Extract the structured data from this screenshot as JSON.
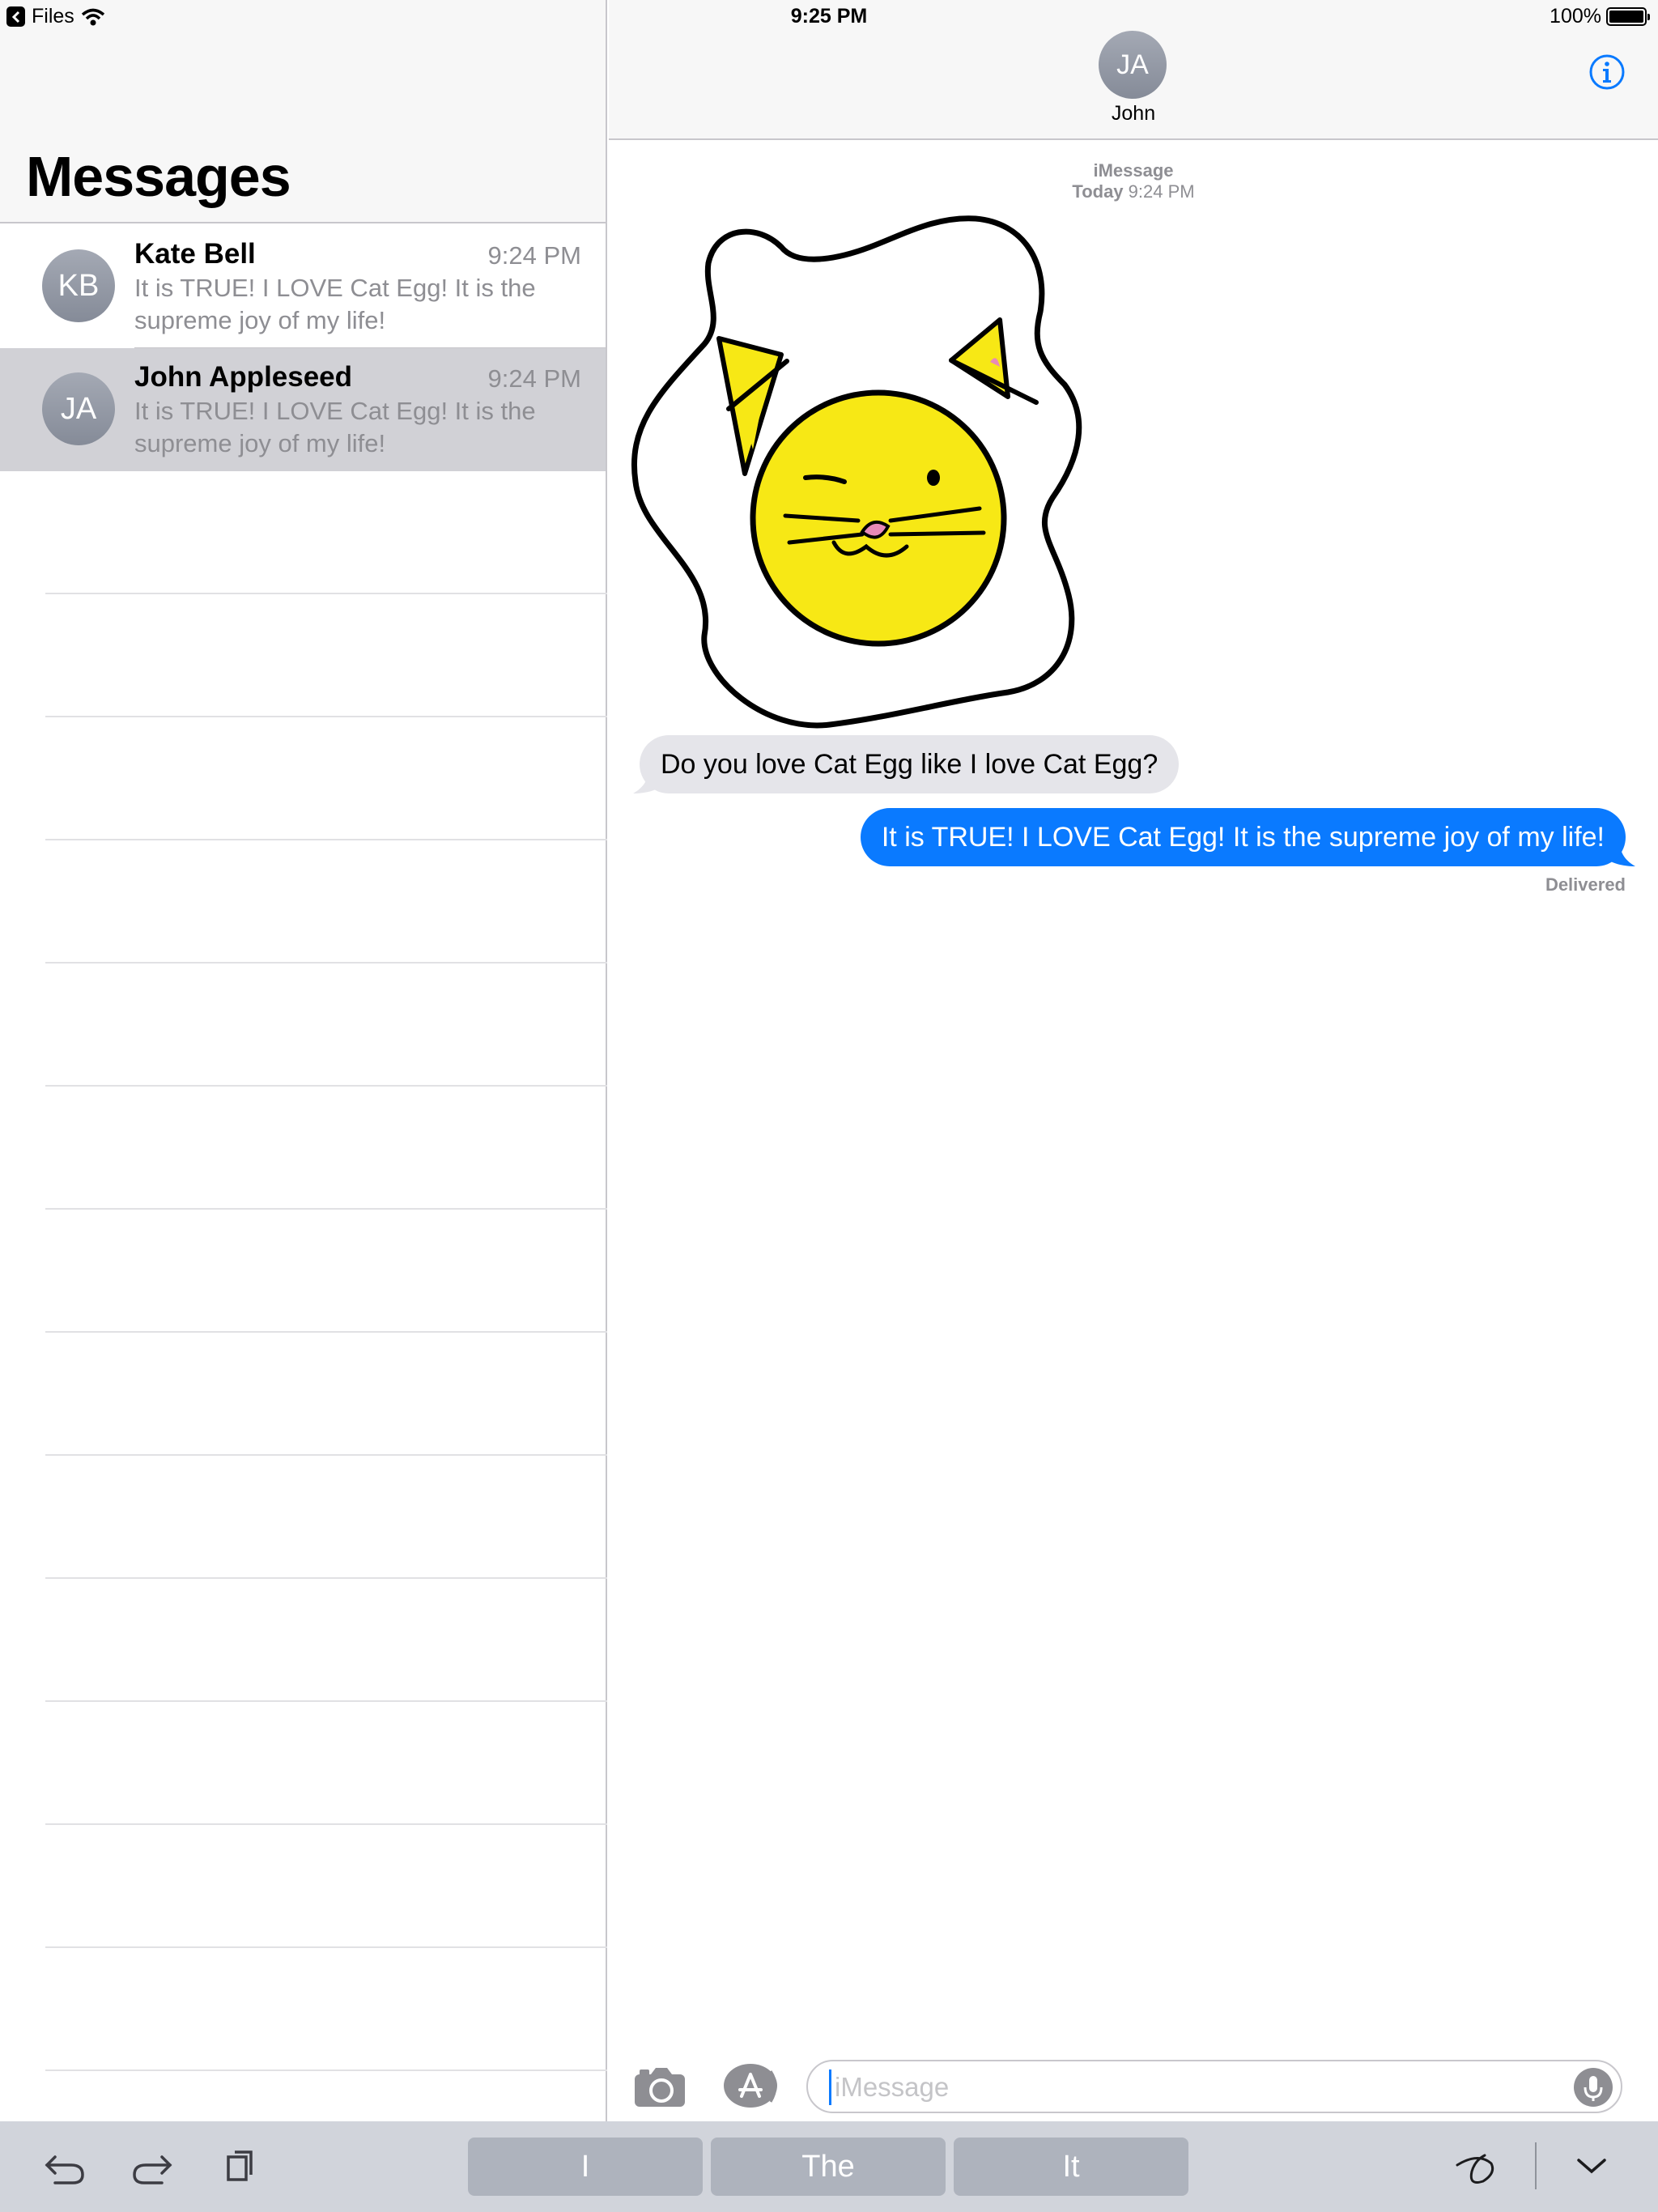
{
  "status_bar": {
    "back_app": "Files",
    "time": "9:25 PM",
    "battery": "100%",
    "battery_level": 1.0
  },
  "sidebar": {
    "title": "Messages",
    "conversations": [
      {
        "initials": "KB",
        "name": "Kate Bell",
        "time": "9:24 PM",
        "preview": "It is TRUE!  I LOVE Cat Egg!  It is the supreme joy of my life!",
        "selected": false
      },
      {
        "initials": "JA",
        "name": "John Appleseed",
        "time": "9:24 PM",
        "preview": "It is TRUE!  I LOVE Cat Egg!  It is the supreme joy of my life!",
        "selected": true
      }
    ]
  },
  "chat": {
    "contact_initials": "JA",
    "contact_name": "John",
    "service": "iMessage",
    "date_day": "Today",
    "date_time": "9:24 PM",
    "sticker": "cat-egg-sticker",
    "incoming_message": "Do you love Cat Egg like I love Cat Egg?",
    "outgoing_message": "It is TRUE!  I LOVE Cat Egg!  It is the supreme joy of my life!",
    "delivery_status": "Delivered"
  },
  "input": {
    "placeholder": "iMessage",
    "value": ""
  },
  "keyboard_bar": {
    "suggestions": [
      "I",
      "The",
      "It"
    ]
  },
  "colors": {
    "accent": "#0a7aff",
    "incoming_bubble": "#e5e5ea",
    "selected_row": "#d1d1d6",
    "egg_yolk": "#f7e815"
  },
  "icons": [
    "back-arrow-icon",
    "wifi-icon",
    "battery-icon",
    "info-icon",
    "camera-icon",
    "app-store-icon",
    "microphone-icon",
    "undo-icon",
    "redo-icon",
    "paste-icon",
    "handwriting-icon",
    "dismiss-keyboard-icon"
  ]
}
